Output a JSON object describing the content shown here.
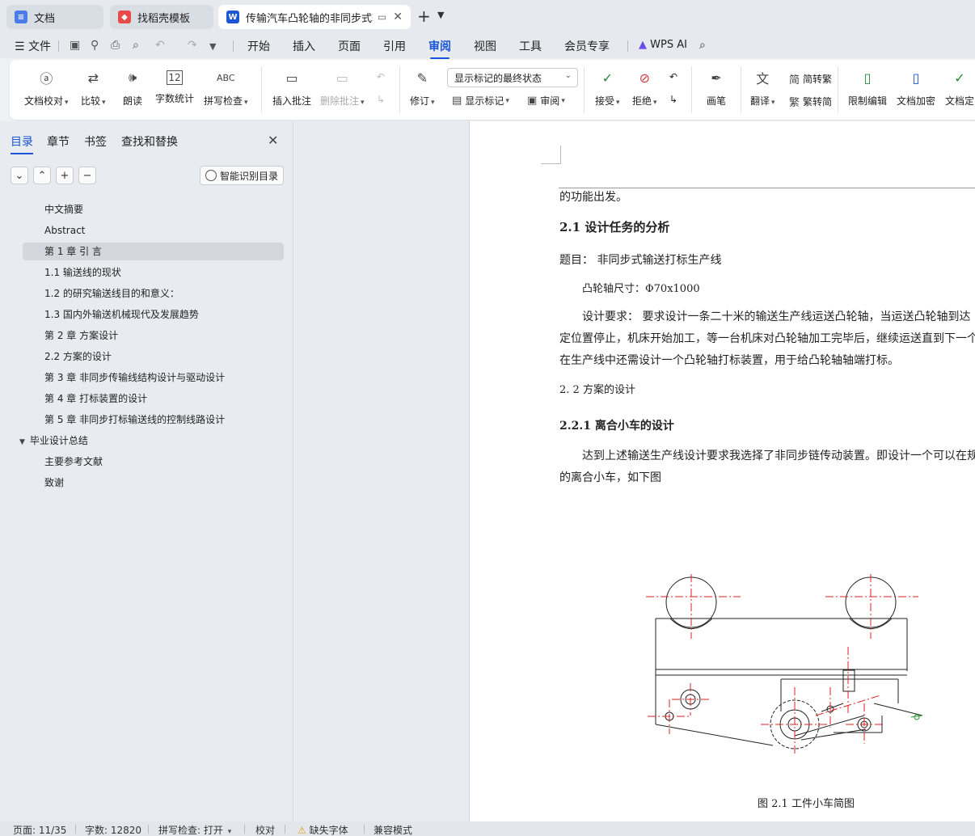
{
  "tabs": [
    {
      "label": "文档",
      "icon": "doc-icon",
      "color": "#4a7de8"
    },
    {
      "label": "找稻壳模板",
      "icon": "docer-icon",
      "color": "#e84a4a"
    },
    {
      "label": "传输汽车凸轮轴的非同步式输送",
      "icon": "word-icon",
      "color": "#1a56d6"
    }
  ],
  "menu": {
    "file_label": "文件",
    "items": [
      "开始",
      "插入",
      "页面",
      "引用",
      "审阅",
      "视图",
      "工具",
      "会员专享"
    ],
    "active": "审阅",
    "wps_ai_label": "WPS AI"
  },
  "ribbon": {
    "buttons": [
      {
        "label": "文档校对",
        "icon": "proofread-icon"
      },
      {
        "label": "比较",
        "icon": "compare-icon"
      },
      {
        "label": "朗读",
        "icon": "read-aloud-icon"
      },
      {
        "label": "字数统计",
        "icon": "word-count-icon",
        "icon_text": "12"
      },
      {
        "label": "拼写检查",
        "icon": "spell-check-icon",
        "icon_text": "ABC"
      },
      {
        "label": "插入批注",
        "icon": "insert-comment-icon"
      },
      {
        "label": "删除批注",
        "icon": "delete-comment-icon"
      },
      {
        "label": "修订",
        "icon": "track-changes-icon"
      },
      {
        "label": "接受",
        "icon": "accept-icon"
      },
      {
        "label": "拒绝",
        "icon": "reject-icon"
      },
      {
        "label": "画笔",
        "icon": "pen-icon"
      },
      {
        "label": "翻译",
        "icon": "translate-icon"
      },
      {
        "label": "限制编辑",
        "icon": "restrict-editing-icon"
      },
      {
        "label": "文档加密",
        "icon": "encrypt-icon"
      },
      {
        "label": "文档定",
        "icon": "finalize-icon"
      }
    ],
    "markup_select": "显示标记的最终状态",
    "show_markup": "显示标记",
    "review": "审阅",
    "to_traditional": "简转繁",
    "to_simplified": "繁转简"
  },
  "nav": {
    "tabs": [
      "目录",
      "章节",
      "书签",
      "查找和替换"
    ],
    "smart_toc_label": "智能识别目录",
    "toc_items": [
      {
        "label": "中文摘要",
        "level": 1
      },
      {
        "label": "Abstract",
        "level": 1
      },
      {
        "label": "第 1 章   引   言",
        "level": 1,
        "selected": true
      },
      {
        "label": "1.1 输送线的现状",
        "level": 1
      },
      {
        "label": "1.2 的研究输送线目的和意义：",
        "level": 1
      },
      {
        "label": "1.3  国内外输送机械现代及发展趋势",
        "level": 1
      },
      {
        "label": "第 2 章    方案设计",
        "level": 1
      },
      {
        "label": "2.2    方案的设计",
        "level": 1
      },
      {
        "label": "第 3 章  非同步传输线结构设计与驱动设计",
        "level": 1
      },
      {
        "label": "第 4 章    打标装置的设计",
        "level": 1
      },
      {
        "label": "第 5 章    非同步打标输送线的控制线路设计",
        "level": 1
      },
      {
        "label": "毕业设计总结",
        "level": 0,
        "expanded": true
      },
      {
        "label": "主要参考文献",
        "level": 1
      },
      {
        "label": "致谢",
        "level": 1
      }
    ]
  },
  "document": {
    "line_top": "的功能出发。",
    "h21": "2.1    设计任务的分析",
    "topic": "题目：  非同步式输送打标生产线",
    "cam_size": "凸轮轴尺寸：Φ70x1000",
    "req1": "设计要求：  要求设计一条二十米的输送生产线运送凸轮轴，当运送凸轮轴到达",
    "req2": "定位置停止，机床开始加工，等一台机床对凸轮轴加工完毕后，继续运送直到下一个",
    "req3": "在生产线中还需设计一个凸轮轴打标装置，用于给凸轮轴轴端打标。",
    "h22": "2. 2    方案的设计",
    "h221": "2.2.1 离合小车的设计",
    "p1": "达到上述输送生产线设计要求我选择了非同步链传动装置。即设计一个可以在规",
    "p2": "的离合小车，如下图",
    "figure_caption": "图 2.1  工件小车简图"
  },
  "status": {
    "page": "页面: 11/35",
    "words": "字数: 12820",
    "spell": "拼写检查: 打开",
    "proof": "校对",
    "missing_font": "缺失字体",
    "compat": "兼容模式"
  }
}
